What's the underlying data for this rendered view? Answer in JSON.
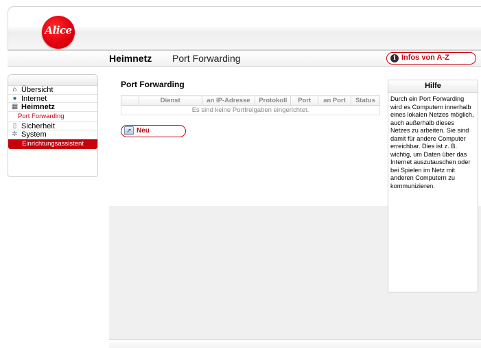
{
  "header": {
    "logo_text": "Alice"
  },
  "titlebar": {
    "section": "Heimnetz",
    "page": "Port Forwarding",
    "infos_label": "Infos von A-Z",
    "infos_icon": "info-icon"
  },
  "nav": {
    "items": [
      {
        "label": "Übersicht",
        "icon": "house-icon"
      },
      {
        "label": "Internet",
        "icon": "globe-icon"
      },
      {
        "label": "Heimnetz",
        "icon": "network-icon"
      },
      {
        "label": "Port Forwarding",
        "icon": ""
      },
      {
        "label": "Sicherheit",
        "icon": "lock-icon"
      },
      {
        "label": "System",
        "icon": "gears-icon"
      }
    ],
    "wizard_label": "Einrichtungsassistent"
  },
  "main": {
    "title": "Port Forwarding",
    "table": {
      "columns": [
        "",
        "Dienst",
        "an IP-Adresse",
        "Protokoll",
        "Port",
        "an Port",
        "Status"
      ],
      "empty_message": "Es sind keine Portfreigaben eingerichtet."
    },
    "new_button_label": "Neu"
  },
  "help": {
    "title": "Hilfe",
    "text": "Durch ein Port Forwarding wird es Computern innerhalb eines lokalen Netzes möglich, auch außerhalb dieses Netzes zu arbeiten. Sie sind damit für andere Computer erreichbar. Dies ist z. B. wichtig, um Daten über das Internet auszutauschen oder bei Spielen im Netz mit anderen Computern zu kommunizieren."
  },
  "colors": {
    "brand_red": "#c8000b",
    "content_gray": "#f0f0f0"
  }
}
